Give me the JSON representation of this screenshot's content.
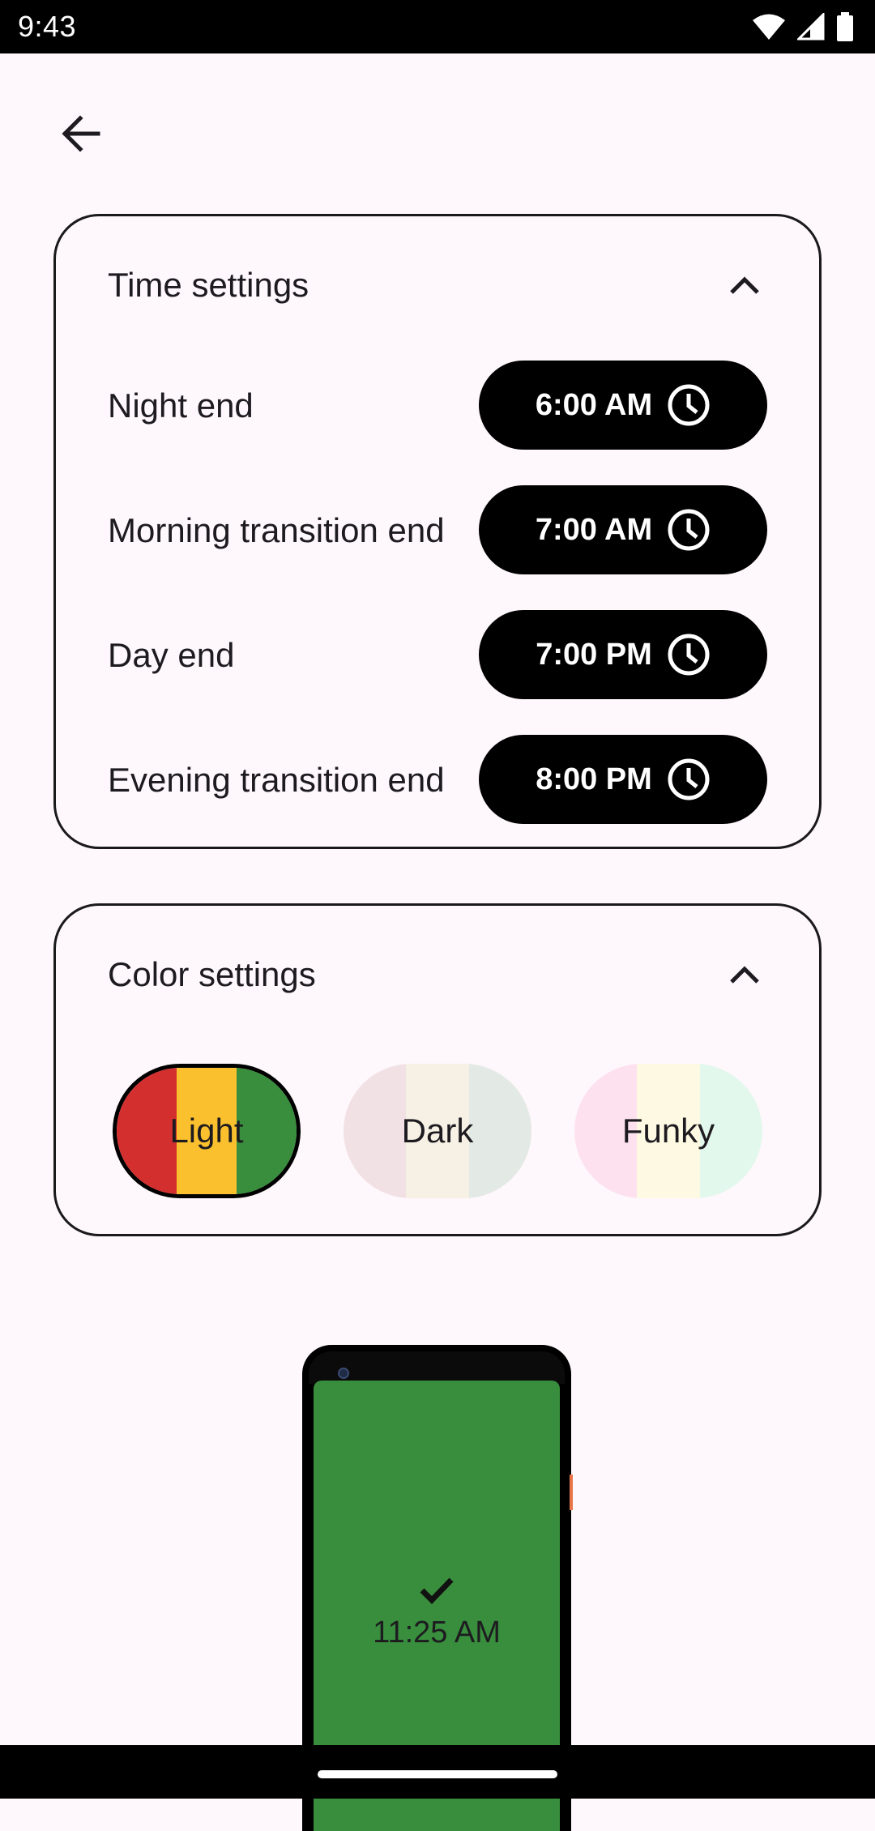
{
  "status_bar": {
    "time": "9:43"
  },
  "time_settings": {
    "title": "Time settings",
    "rows": [
      {
        "label": "Night end",
        "time": "6:00 AM"
      },
      {
        "label": "Morning transition end",
        "time": "7:00 AM"
      },
      {
        "label": "Day end",
        "time": "7:00 PM"
      },
      {
        "label": "Evening transition end",
        "time": "8:00 PM"
      }
    ]
  },
  "color_settings": {
    "title": "Color settings",
    "themes": [
      {
        "label": "Light",
        "selected": true,
        "colors": [
          "#D32F2F",
          "#FBC02D",
          "#388E3C"
        ]
      },
      {
        "label": "Dark",
        "selected": false,
        "colors": [
          "#F2E1E4",
          "#F7F0E4",
          "#E3E9E4"
        ]
      },
      {
        "label": "Funky",
        "selected": false,
        "colors": [
          "#FDE1EF",
          "#FEF9E2",
          "#E3F8EC"
        ]
      }
    ]
  },
  "preview": {
    "time": "11:25 AM",
    "screen_color": "#388E3C"
  }
}
